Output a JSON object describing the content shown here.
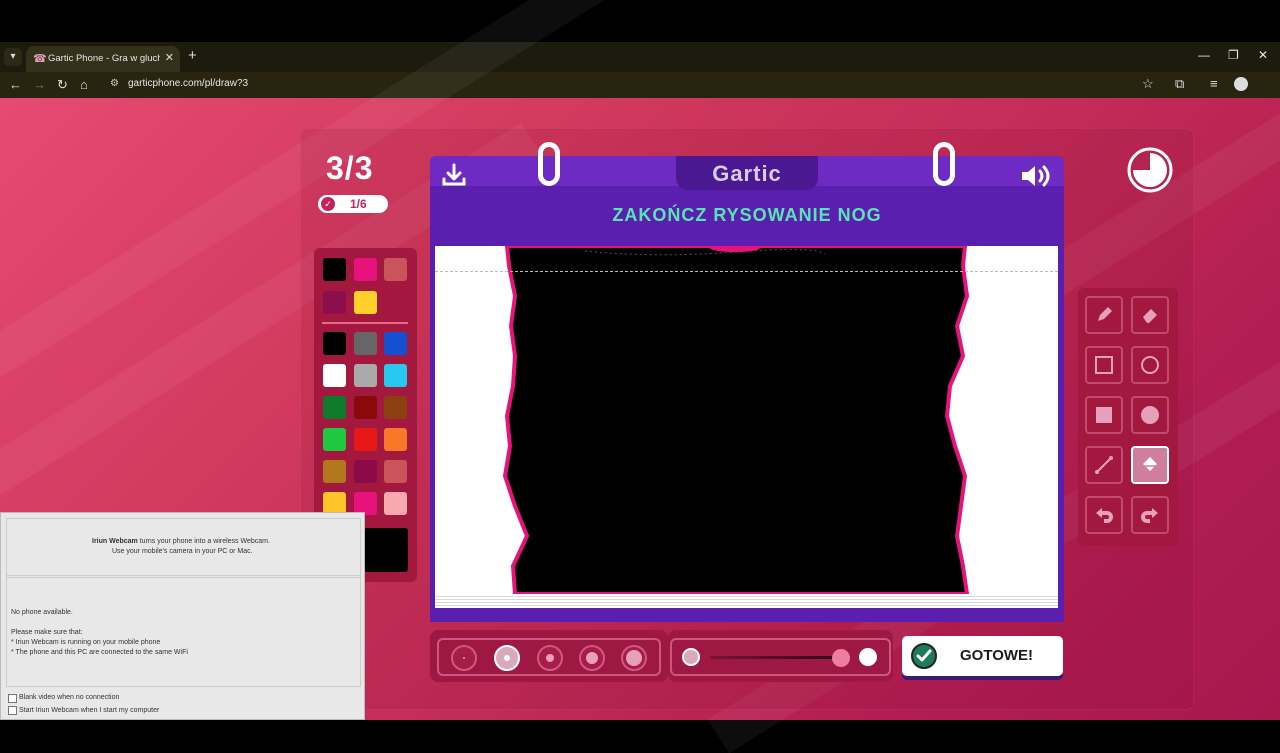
{
  "browser": {
    "tab_title": "Gartic Phone - Gra w gluchy tel",
    "tab_favicon": "☎",
    "url": "garticphone.com/pl/draw?3"
  },
  "game": {
    "round": "3/3",
    "players_done": "1/6",
    "logo": "Gartic",
    "instruction": "ZAKOŃCZ RYSOWANIE NOG",
    "done_button": "GOTOWE!",
    "colors": {
      "header_purple": "#5b1fb0",
      "title_green": "#58e6b0",
      "panel_red": "#a3183f",
      "drawing_pink": "#e8127c"
    },
    "palette_top": [
      "#000000",
      "#e8127c",
      "#c9545a",
      "#8b0f4a",
      "#ffd02a"
    ],
    "palette_main": [
      "#000000",
      "#666666",
      "#1450d2",
      "#ffffff",
      "#aaaaaa",
      "#28c8f0",
      "#0f7a2a",
      "#8a0a0a",
      "#8c4012",
      "#20c840",
      "#e81818",
      "#f8782a",
      "#b0781a",
      "#8c0a4a",
      "#c9545a",
      "#ffc42a",
      "#e8127c",
      "#f8a8b0"
    ],
    "current_color": "#000000",
    "tools": [
      "pencil-icon",
      "eraser-icon",
      "rectangle-outline-icon",
      "circle-outline-icon",
      "rectangle-fill-icon",
      "circle-fill-icon",
      "line-icon",
      "bucket-icon",
      "undo-icon",
      "redo-icon"
    ],
    "active_tool": "bucket-icon",
    "brush_size_selected": 2,
    "opacity": 1.0
  },
  "iriun": {
    "title_bold": "Iriun Webcam",
    "title_rest": " turns your phone into a wireless Webcam.",
    "subtitle": "Use your mobile's camera in your PC or Mac.",
    "no_phone": "No phone available.",
    "make_sure": "Please make sure that:",
    "bullet1": "* Iriun Webcam is running on your mobile phone",
    "bullet2": "* The phone and this PC are connected to the same WiFi",
    "check1": "Blank video when no connection",
    "check2": "Start Iriun Webcam when I start my computer"
  }
}
